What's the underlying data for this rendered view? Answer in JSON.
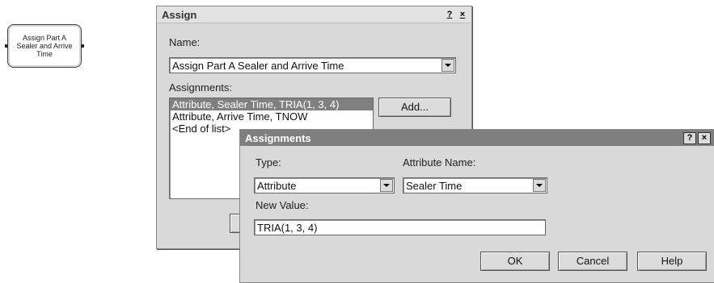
{
  "module": {
    "lines": [
      "Assign Part A",
      "Sealer and Arrive",
      "Time"
    ]
  },
  "assign_dialog": {
    "title": "Assign",
    "help_btn": "?",
    "close_btn": "×",
    "name_label": "Name:",
    "name_value": "Assign Part A Sealer and Arrive Time",
    "assignments_label": "Assignments:",
    "assignments": [
      "Attribute, Sealer Time, TRIA(1, 3, 4)",
      "Attribute, Arrive Time, TNOW",
      "<End of list>"
    ],
    "add_button": "Add..."
  },
  "assignments_dialog": {
    "title": "Assignments",
    "help_btn": "?",
    "close_btn": "×",
    "type_label": "Type:",
    "type_value": "Attribute",
    "attr_label": "Attribute Name:",
    "attr_value": "Sealer Time",
    "new_value_label": "New Value:",
    "new_value": "TRIA(1, 3, 4)",
    "ok_button": "OK",
    "cancel_button": "Cancel",
    "help_button": "Help"
  }
}
